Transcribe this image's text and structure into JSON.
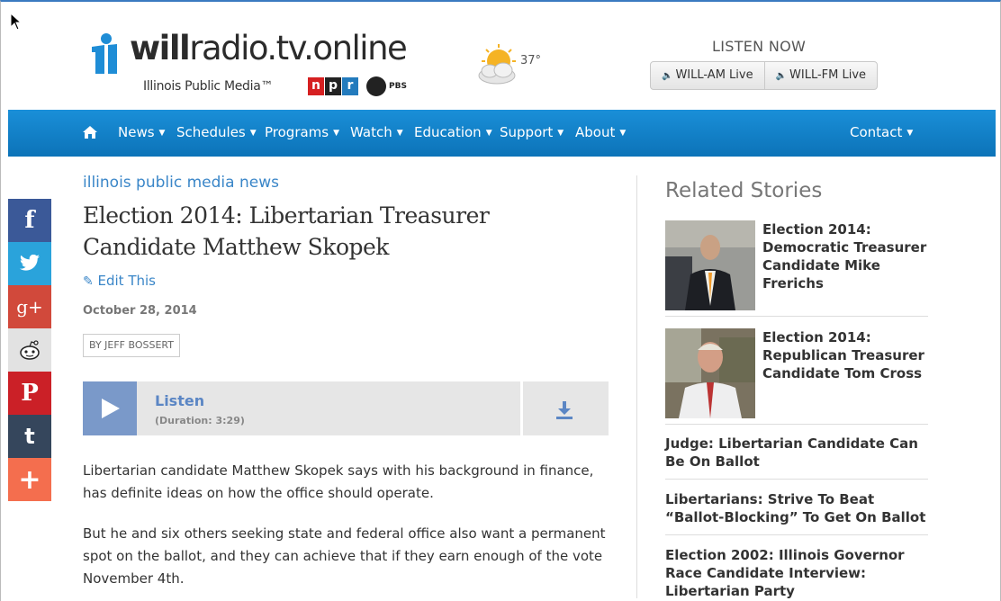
{
  "header": {
    "logo_text_bold": "will",
    "logo_text_rest": "radio.tv.online",
    "logo_sub": "Illinois Public Media™",
    "npr_letters": [
      "n",
      "p",
      "r"
    ],
    "pbs_label": "PBS",
    "weather_icon": "partly-cloudy-icon",
    "temperature": "37°",
    "listen_now": "LISTEN NOW",
    "live_buttons": [
      "WILL-AM Live",
      "WILL-FM Live"
    ]
  },
  "nav": {
    "items": [
      "News",
      "Schedules",
      "Programs",
      "Watch",
      "Education",
      "Support",
      "About"
    ],
    "contact": "Contact"
  },
  "share": {
    "buttons": [
      {
        "name": "facebook",
        "glyph": "f",
        "color": "#3b5998"
      },
      {
        "name": "twitter",
        "glyph": "t",
        "color": "#2aa3db"
      },
      {
        "name": "google-plus",
        "glyph": "g+",
        "color": "#d1493b"
      },
      {
        "name": "reddit",
        "glyph": "",
        "color": "#e2e2e2"
      },
      {
        "name": "pinterest",
        "glyph": "P",
        "color": "#cb2027"
      },
      {
        "name": "tumblr",
        "glyph": "t",
        "color": "#35465c"
      },
      {
        "name": "more",
        "glyph": "+",
        "color": "#f46e4e"
      }
    ]
  },
  "article": {
    "kicker": "illinois public media news",
    "headline": "Election 2014: Libertarian Treasurer Candidate Matthew Skopek",
    "edit_label": "Edit This",
    "date": "October 28, 2014",
    "byline": "BY JEFF BOSSERT",
    "player": {
      "title": "Listen",
      "duration": "(Duration: 3:29)"
    },
    "paragraphs": [
      "Libertarian candidate Matthew Skopek says with his background in finance, has definite ideas on how the office should operate.",
      "But he and six others seeking state and federal office also want a permanent spot on the ballot, and they can achieve that if they earn enough of the vote November 4th."
    ]
  },
  "related": {
    "title": "Related Stories",
    "items": [
      {
        "title": "Election 2014: Democratic Treasurer Candidate Mike Frerichs"
      },
      {
        "title": "Election 2014: Republican Treasurer Candidate Tom Cross"
      },
      {
        "title": "Judge: Libertarian Candidate Can Be On Ballot"
      },
      {
        "title": "Libertarians: Strive To Beat “Ballot-Blocking” To Get On Ballot"
      },
      {
        "title": "Election 2002: Illinois Governor Race Candidate Interview: Libertarian Party"
      }
    ]
  },
  "colors": {
    "nav_blue": "#1180c9",
    "link_blue": "#3a86c8",
    "player_blue": "#7a99c9",
    "npr_red": "#d62021",
    "npr_black": "#222222",
    "npr_blue": "#237bbd"
  }
}
